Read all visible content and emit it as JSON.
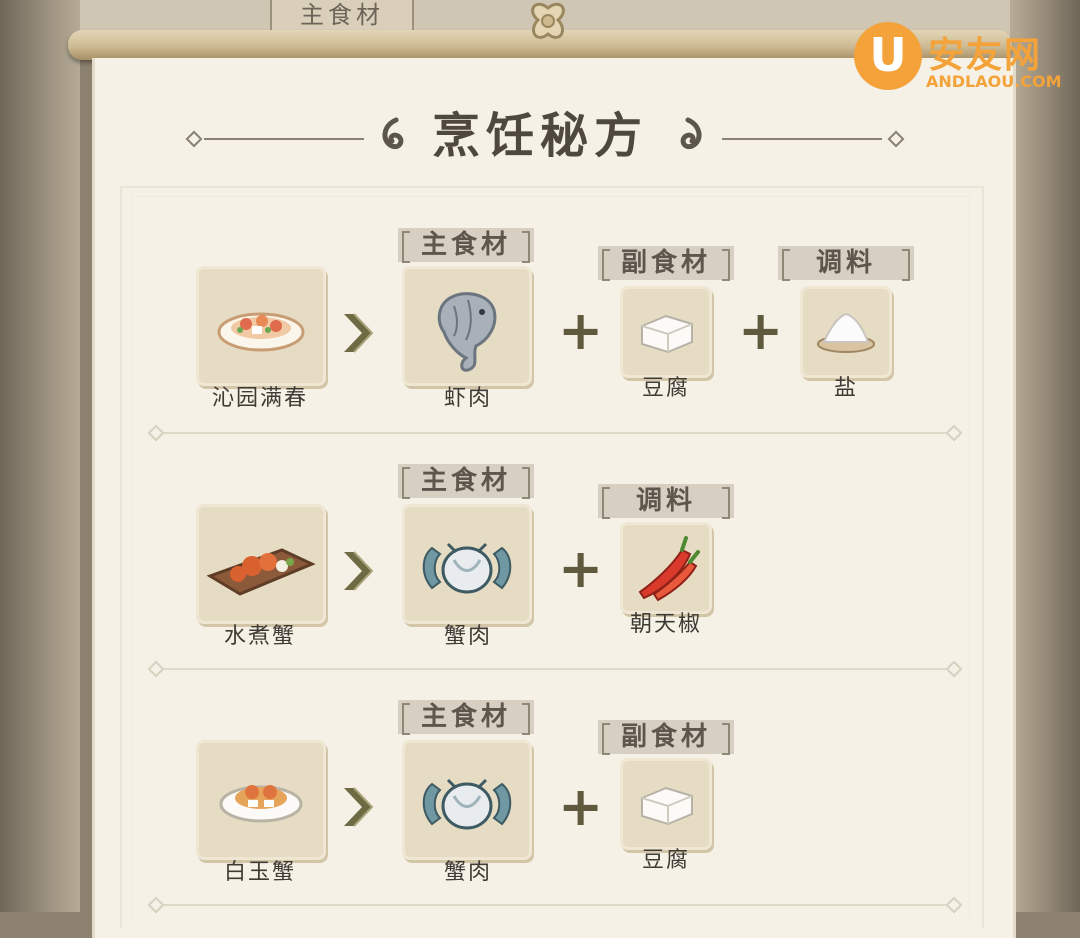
{
  "header": {
    "top_tab_label": "主食材",
    "title": "烹饪秘方"
  },
  "watermark": {
    "logo_letter": "U",
    "name": "安友网",
    "domain": "ANDLAOU.COM"
  },
  "labels": {
    "main_ingredient": "主食材",
    "side_ingredient": "副食材",
    "seasoning": "调料"
  },
  "recipes": [
    {
      "dish": "沁园满春",
      "dish_icon": "dish-plate-icon",
      "main": "虾肉",
      "main_icon": "shrimp-icon",
      "side": "豆腐",
      "side_icon": "tofu-icon",
      "seasoning": "盐",
      "seasoning_icon": "salt-icon"
    },
    {
      "dish": "水煮蟹",
      "dish_icon": "crab-board-icon",
      "main": "蟹肉",
      "main_icon": "crab-icon",
      "seasoning": "朝天椒",
      "seasoning_icon": "chili-pepper-icon"
    },
    {
      "dish": "白玉蟹",
      "dish_icon": "crab-plate-icon",
      "main": "蟹肉",
      "main_icon": "crab-icon",
      "side": "豆腐",
      "side_icon": "tofu-icon"
    }
  ],
  "colors": {
    "parchment": "#f5f1e6",
    "card": "#e6dcc3",
    "tag": "#d7cfc1",
    "text": "#3f3a33",
    "watermark": "#f4a23a"
  }
}
